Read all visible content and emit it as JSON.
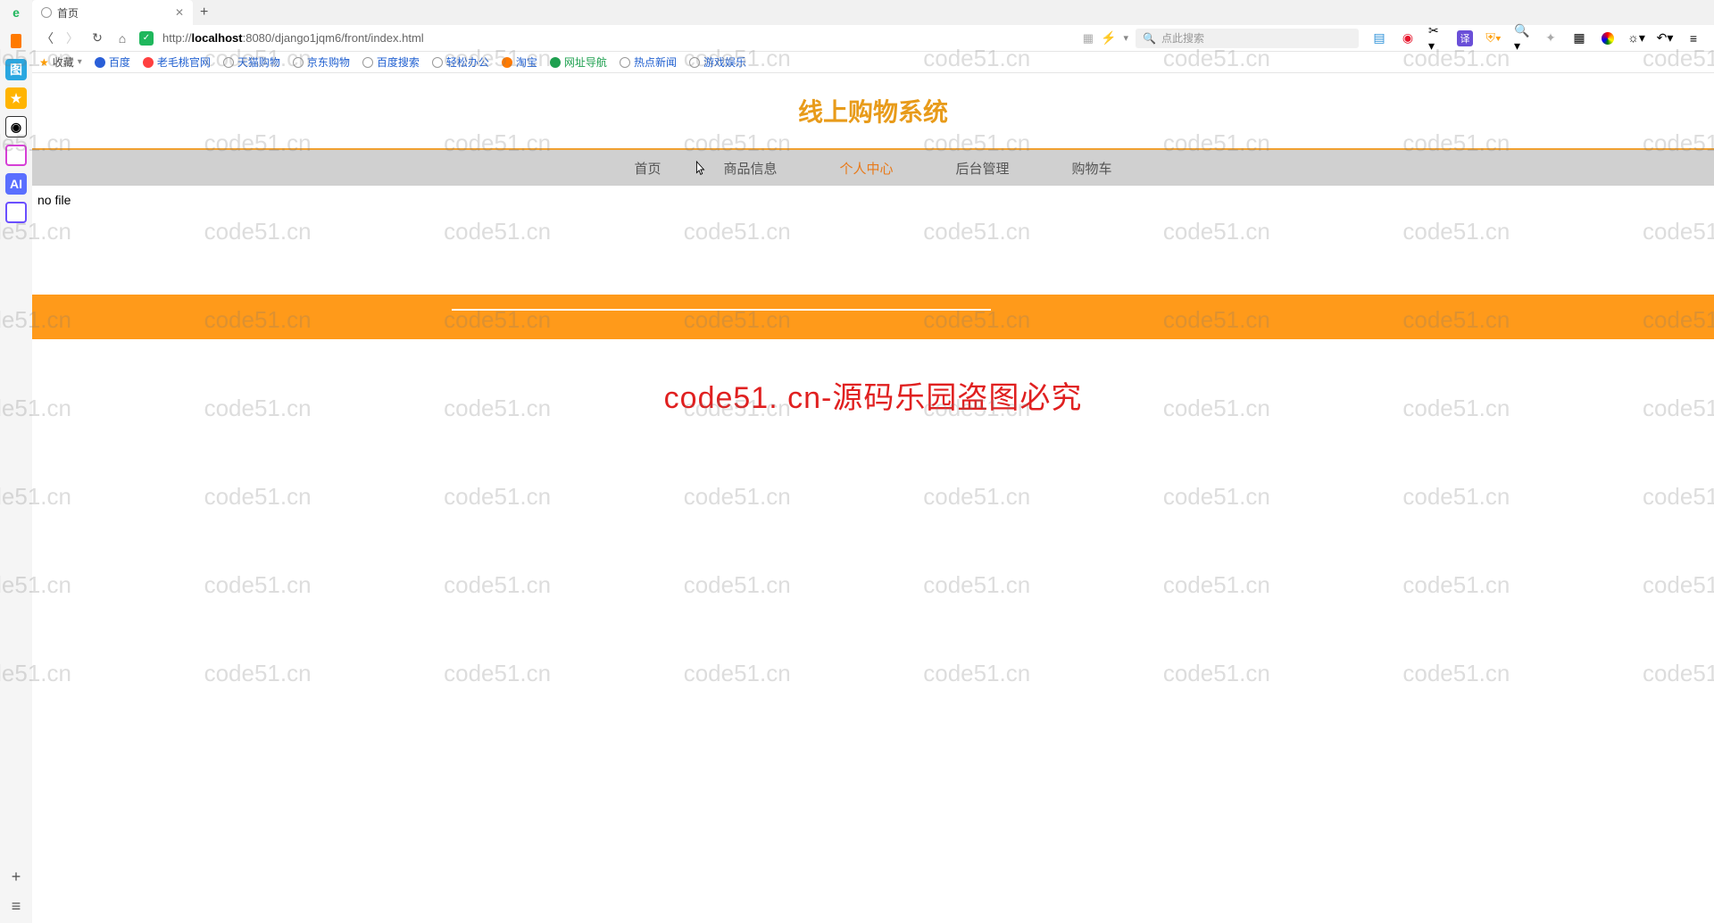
{
  "browser": {
    "tab_title": "首页",
    "url_prefix": "http://",
    "url_host": "localhost",
    "url_suffix": ":8080/django1jqm6/front/index.html",
    "search_placeholder": "点此搜索"
  },
  "bookmarks": {
    "fav": "收藏",
    "items": [
      "百度",
      "老毛桃官网",
      "天猫购物",
      "京东购物",
      "百度搜索",
      "轻松办公",
      "淘宝",
      "网址导航",
      "热点新闻",
      "游戏娱乐"
    ]
  },
  "page": {
    "title": "线上购物系统",
    "nav": [
      "首页",
      "商品信息",
      "个人中心",
      "后台管理",
      "购物车"
    ],
    "nav_active_index": 2,
    "nofile": "no file",
    "warning": "code51. cn-源码乐园盗图必究"
  },
  "watermark_text": "code51.cn"
}
